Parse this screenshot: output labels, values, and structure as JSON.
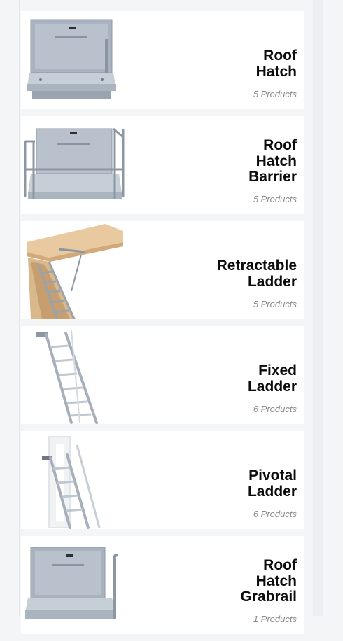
{
  "products": [
    {
      "title": "Roof\nHatch",
      "count": "5 Products",
      "icon": "roof-hatch-image"
    },
    {
      "title": "Roof\nHatch\nBarrier",
      "count": "5 Products",
      "icon": "roof-hatch-barrier-image"
    },
    {
      "title": "Retractable\nLadder",
      "count": "5 Products",
      "icon": "retractable-ladder-image"
    },
    {
      "title": "Fixed\nLadder",
      "count": "6 Products",
      "icon": "fixed-ladder-image"
    },
    {
      "title": "Pivotal\nLadder",
      "count": "6 Products",
      "icon": "pivotal-ladder-image"
    },
    {
      "title": "Roof\nHatch\nGrabrail",
      "count": "1 Products",
      "icon": "roof-hatch-grabrail-image"
    }
  ]
}
